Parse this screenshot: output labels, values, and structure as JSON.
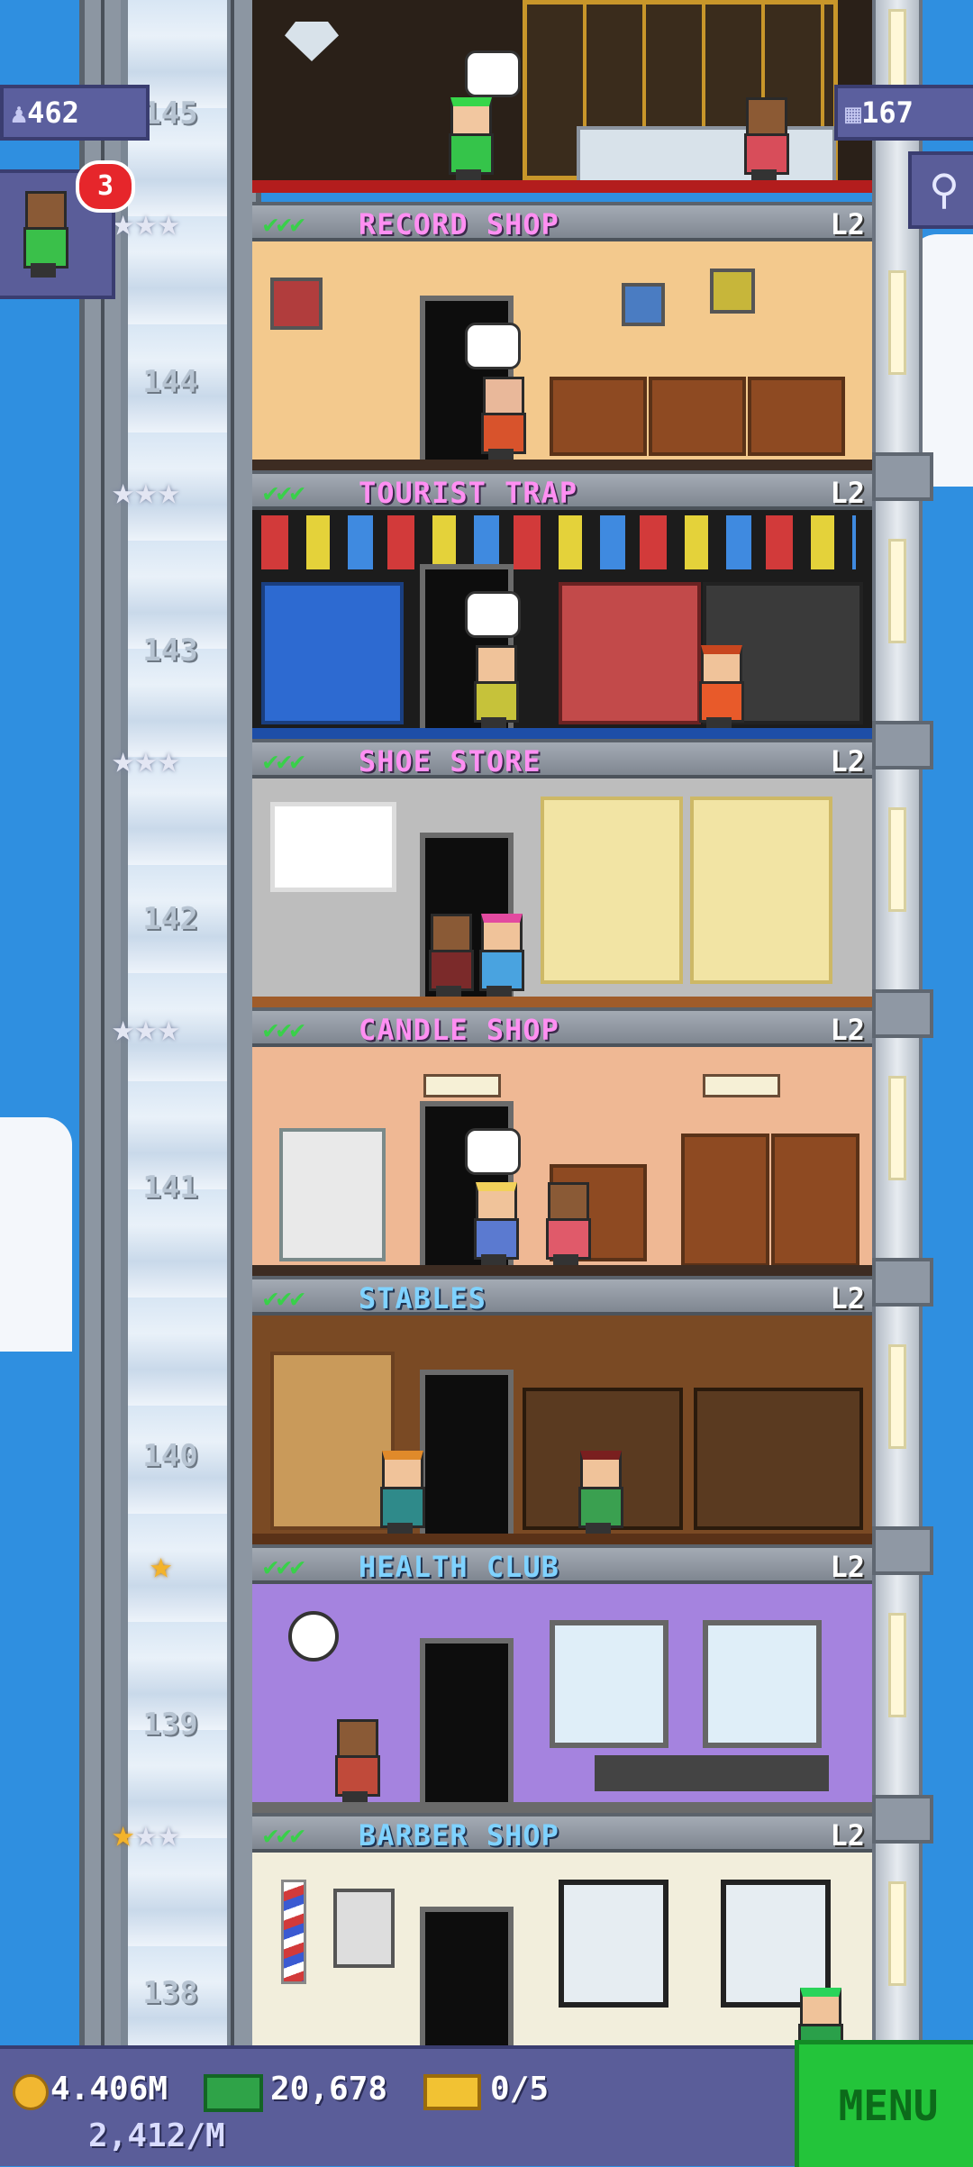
{
  "top": {
    "population": "462",
    "floors_count": "167",
    "visitor_notifications": "3"
  },
  "floors": [
    {
      "number": "145",
      "name": "",
      "level": "",
      "stars_gold": 0,
      "stars_total": 0
    },
    {
      "number": "144",
      "name": "RECORD SHOP",
      "level": "L2",
      "stars_gold": 0,
      "stars_total": 3
    },
    {
      "number": "143",
      "name": "TOURIST TRAP",
      "level": "L2",
      "stars_gold": 0,
      "stars_total": 3
    },
    {
      "number": "142",
      "name": "SHOE STORE",
      "level": "L2",
      "stars_gold": 0,
      "stars_total": 3
    },
    {
      "number": "141",
      "name": "CANDLE SHOP",
      "level": "L2",
      "stars_gold": 0,
      "stars_total": 3
    },
    {
      "number": "140",
      "name": "STABLES",
      "level": "L2",
      "stars_gold": 0,
      "stars_total": 0
    },
    {
      "number": "139",
      "name": "HEALTH CLUB",
      "level": "L2",
      "stars_gold": 1,
      "stars_total": 1
    },
    {
      "number": "138",
      "name": "BARBER SHOP",
      "level": "L2",
      "stars_gold": 1,
      "stars_total": 3
    }
  ],
  "header_checks": "✔✔✔",
  "bottom": {
    "coins": "4.406M",
    "coins_rate": "2,412/M",
    "tower_bux": "20,678",
    "vip_tickets": "0/5",
    "menu_label": "MENU"
  },
  "colors": {
    "sky": "#2f8fe0",
    "shop_label": "#ff8ff2",
    "service_label": "#7fd2ff",
    "menu_button": "#23c43a",
    "panel": "#5a5d99"
  }
}
